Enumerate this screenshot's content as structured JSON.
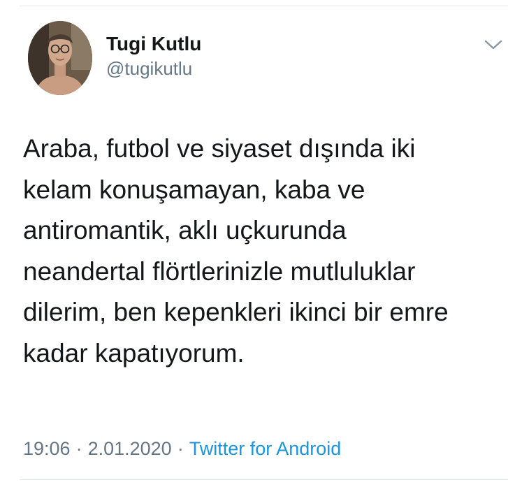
{
  "author": {
    "display_name": "Tugi Kutlu",
    "handle": "@tugikutlu"
  },
  "tweet": {
    "lines": [
      "Araba, futbol ve siyaset dışında iki",
      "kelam konuşamayan, kaba ve",
      "antiromantik, aklı uçkurunda",
      "neandertal flörtlerinizle mutluluklar",
      "dilerim, ben kepenkleri ikinci bir emre",
      "kadar kapatıyorum."
    ]
  },
  "meta": {
    "time": "19:06",
    "separator": "·",
    "date": "2.01.2020",
    "source": "Twitter for Android"
  },
  "icons": {
    "menu": "chevron-down-icon"
  },
  "colors": {
    "text": "#14171a",
    "secondary": "#657786",
    "link": "#1b95e0",
    "divider": "#e1e8ed"
  }
}
